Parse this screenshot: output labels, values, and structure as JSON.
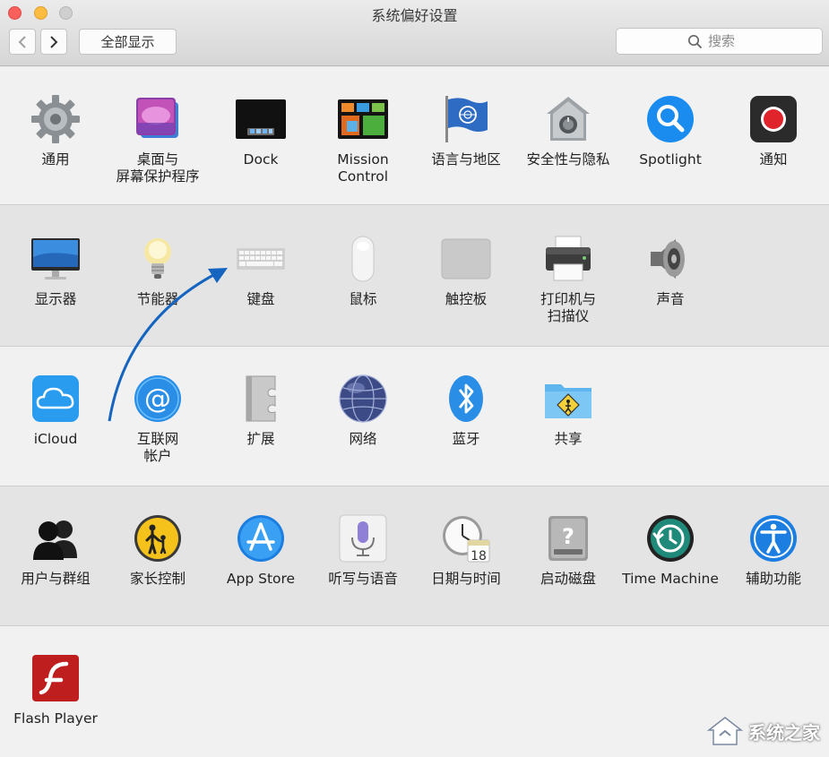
{
  "window": {
    "title": "系统偏好设置"
  },
  "toolbar": {
    "show_all_label": "全部显示",
    "search_placeholder": "搜索"
  },
  "panes": {
    "row1": [
      {
        "label": "通用",
        "icon": "gear-icon"
      },
      {
        "label": "桌面与\n屏幕保护程序",
        "icon": "desktop-icon"
      },
      {
        "label": "Dock",
        "icon": "dock-icon"
      },
      {
        "label": "Mission\nControl",
        "icon": "mission-control-icon"
      },
      {
        "label": "语言与地区",
        "icon": "un-flag-icon"
      },
      {
        "label": "安全性与隐私",
        "icon": "house-safe-icon"
      },
      {
        "label": "Spotlight",
        "icon": "spotlight-icon"
      },
      {
        "label": "通知",
        "icon": "notifications-icon"
      }
    ],
    "row2": [
      {
        "label": "显示器",
        "icon": "display-icon"
      },
      {
        "label": "节能器",
        "icon": "lightbulb-icon"
      },
      {
        "label": "键盘",
        "icon": "keyboard-icon"
      },
      {
        "label": "鼠标",
        "icon": "mouse-icon"
      },
      {
        "label": "触控板",
        "icon": "trackpad-icon"
      },
      {
        "label": "打印机与\n扫描仪",
        "icon": "printer-icon"
      },
      {
        "label": "声音",
        "icon": "speaker-icon"
      }
    ],
    "row3": [
      {
        "label": "iCloud",
        "icon": "icloud-icon"
      },
      {
        "label": "互联网\n帐户",
        "icon": "at-sign-icon"
      },
      {
        "label": "扩展",
        "icon": "extensions-icon"
      },
      {
        "label": "网络",
        "icon": "globe-icon"
      },
      {
        "label": "蓝牙",
        "icon": "bluetooth-icon"
      },
      {
        "label": "共享",
        "icon": "shared-folder-icon"
      }
    ],
    "row4": [
      {
        "label": "用户与群组",
        "icon": "users-icon"
      },
      {
        "label": "家长控制",
        "icon": "parental-controls-icon"
      },
      {
        "label": "App Store",
        "icon": "app-store-icon"
      },
      {
        "label": "听写与语音",
        "icon": "microphone-icon"
      },
      {
        "label": "日期与时间",
        "icon": "clock-calendar-icon"
      },
      {
        "label": "启动磁盘",
        "icon": "hard-disk-icon"
      },
      {
        "label": "Time Machine",
        "icon": "time-machine-icon"
      },
      {
        "label": "辅助功能",
        "icon": "accessibility-icon"
      }
    ],
    "row5": [
      {
        "label": "Flash Player",
        "icon": "flash-icon"
      }
    ],
    "calendar_day": "18"
  },
  "watermark": {
    "text": "系统之家"
  },
  "colors": {
    "arrow": "#1565c0",
    "accent_blue": "#1a8cf0"
  }
}
